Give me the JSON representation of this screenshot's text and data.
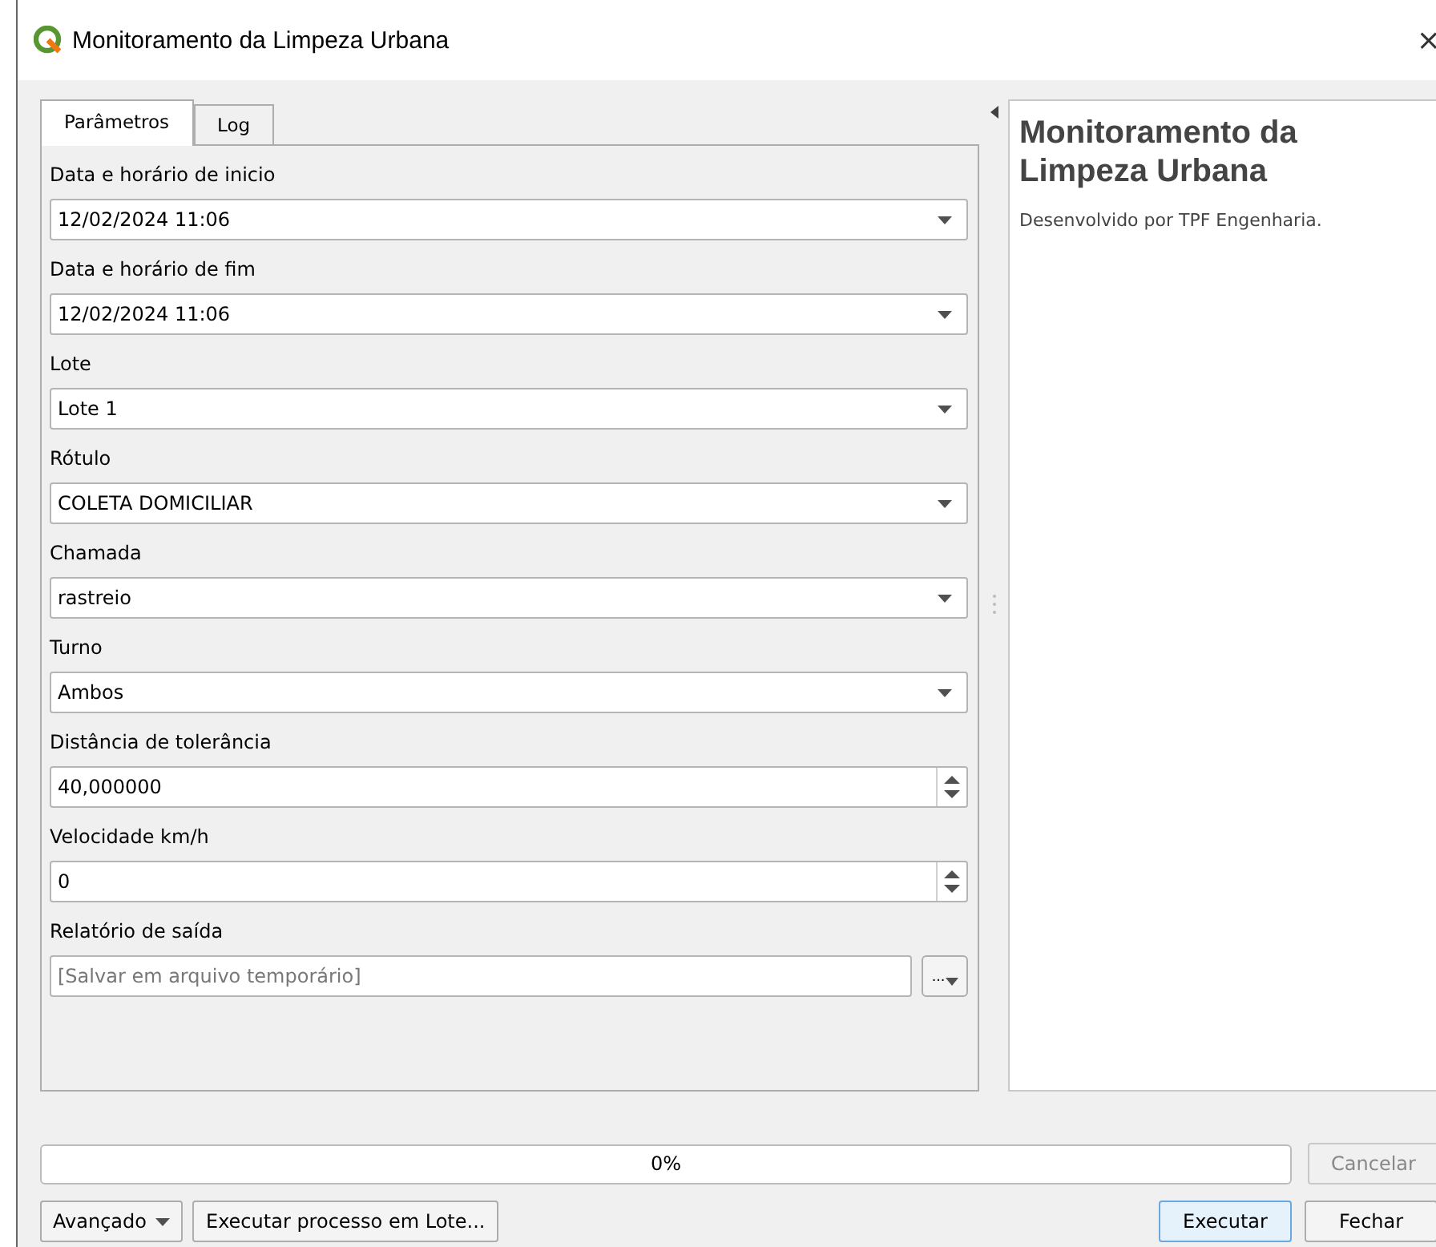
{
  "window": {
    "title": "Monitoramento da Limpeza Urbana",
    "close": "×"
  },
  "tabs": [
    {
      "label": "Parâmetros",
      "selected": true
    },
    {
      "label": "Log",
      "selected": false
    }
  ],
  "parameters": [
    {
      "label": "Data e horário de inicio",
      "kind": "combo",
      "value": "12/02/2024 11:06"
    },
    {
      "label": "Data e horário de fim",
      "kind": "combo",
      "value": "12/02/2024 11:06"
    },
    {
      "label": "Lote",
      "kind": "combo",
      "value": "Lote 1"
    },
    {
      "label": "Rótulo",
      "kind": "combo",
      "value": "COLETA DOMICILIAR"
    },
    {
      "label": "Chamada",
      "kind": "combo",
      "value": "rastreio"
    },
    {
      "label": "Turno",
      "kind": "combo",
      "value": "Ambos"
    },
    {
      "label": "Distância de tolerância",
      "kind": "spin",
      "value": "40,000000"
    },
    {
      "label": "Velocidade km/h",
      "kind": "spin",
      "value": "0"
    },
    {
      "label": "Relatório de saída",
      "kind": "file",
      "placeholder": "[Salvar em arquivo temporário]",
      "button": "..."
    }
  ],
  "help": {
    "title": "Monitoramento da Limpeza Urbana",
    "text": "Desenvolvido por TPF Engenharia."
  },
  "progress": {
    "level": 0,
    "text": "0%"
  },
  "buttons": [
    {
      "label": "Cancelar",
      "disabled": true,
      "default": false
    },
    {
      "label": "Avançado",
      "disabled": false,
      "default": false,
      "kind": "menu"
    },
    {
      "label": "Executar processo em Lote...",
      "disabled": false,
      "default": false
    },
    {
      "label": "Executar",
      "disabled": false,
      "default": true
    },
    {
      "label": "Fechar",
      "disabled": false,
      "default": false
    }
  ]
}
